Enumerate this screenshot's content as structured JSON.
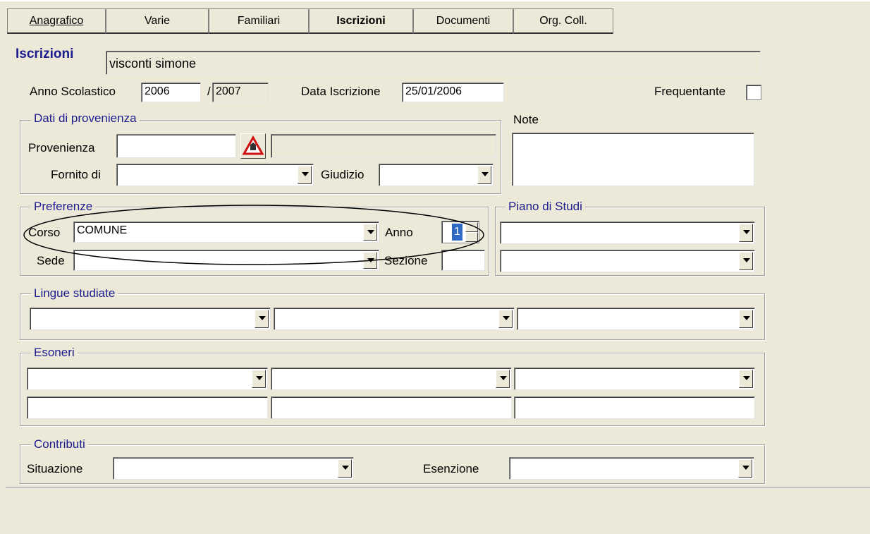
{
  "tabs": [
    {
      "label": "Anagrafico",
      "active": false
    },
    {
      "label": "Varie",
      "active": false
    },
    {
      "label": "Familiari",
      "active": false
    },
    {
      "label": "Iscrizioni",
      "active": true
    },
    {
      "label": "Documenti",
      "active": false
    },
    {
      "label": "Org. Coll.",
      "active": false
    }
  ],
  "header": {
    "title": "Iscrizioni",
    "student_name": "visconti simone"
  },
  "anno": {
    "label": "Anno Scolastico",
    "start": "2006",
    "separator": "/",
    "end": "2007"
  },
  "data_iscrizione": {
    "label": "Data Iscrizione",
    "value": "25/01/2006"
  },
  "frequentante": {
    "label": "Frequentante",
    "checked": false
  },
  "provenienza_group": {
    "title": "Dati di provenienza",
    "provenienza_label": "Provenienza",
    "provenienza_value": "",
    "provenienza_desc": "",
    "fornito_label": "Fornito di",
    "fornito_value": "",
    "giudizio_label": "Giudizio",
    "giudizio_value": ""
  },
  "note": {
    "label": "Note",
    "value": ""
  },
  "preferenze": {
    "title": "Preferenze",
    "corso_label": "Corso",
    "corso_value": "COMUNE",
    "anno_label": "Anno",
    "anno_value": "1",
    "sede_label": "Sede",
    "sede_value": "",
    "sezione_label": "Sezione",
    "sezione_value": ""
  },
  "piano_studi": {
    "title": "Piano di Studi",
    "values": [
      "",
      ""
    ]
  },
  "lingue": {
    "title": "Lingue studiate",
    "values": [
      "",
      "",
      ""
    ]
  },
  "esoneri": {
    "title": "Esoneri",
    "dropdowns": [
      "",
      "",
      ""
    ],
    "fields": [
      "",
      "",
      ""
    ]
  },
  "contributi": {
    "title": "Contributi",
    "situazione_label": "Situazione",
    "situazione_value": "",
    "esenzione_label": "Esenzione",
    "esenzione_value": ""
  },
  "colors": {
    "window_bg": "#ECE9D8",
    "label_blue": "#1C1C8F",
    "field_bg": "#FFFFFF"
  }
}
